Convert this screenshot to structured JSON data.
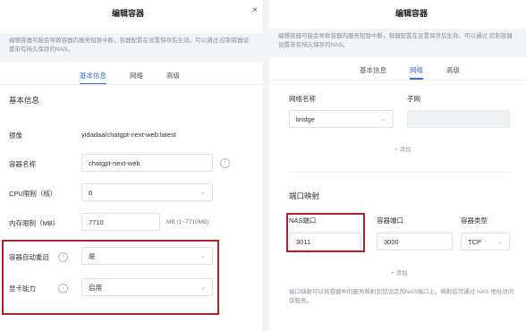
{
  "left_dialog": {
    "title": "编辑容器",
    "notice": "编辑容器可能会导致容器内服务短暂中断，容器配置在设置保存后生效。可以通过 控制容器设置带有持久保存的NAS。",
    "tabs": [
      "基本信息",
      "网络",
      "高级"
    ],
    "section_title": "基本信息",
    "rows": {
      "image_label": "镜像",
      "image_value": "yidadaa/chatgpt-next-web:latest",
      "container_name_label": "容器名称",
      "container_name_value": "chatgpt-next-web",
      "cpu_label": "CPU限制（核）",
      "cpu_value": "6",
      "memory_label": "内存限制（MB）",
      "memory_value": "7710",
      "memory_unit": "MB (1~7710MB)",
      "autostart_label": "容器自动重启",
      "autostart_value": "是",
      "gpu_label": "显卡能力",
      "gpu_value": "启用"
    }
  },
  "right_dialog": {
    "title": "编辑容器",
    "notice": "编辑容器可能会导致容器内服务短暂中断，容器配置在设置保存后生效。可以通过 控制容器设置带有持久保存的NAS。",
    "tabs": [
      "基本信息",
      "网络",
      "高级"
    ],
    "network": {
      "mode_label": "网络名称",
      "mode_value": "bridge",
      "subnet_label": "子网",
      "add_label": "+ 添加"
    },
    "port_section_title": "端口映射",
    "ports": {
      "nas_port_label": "NAS端口",
      "nas_port_value": "3011",
      "container_port_label": "容器端口",
      "container_port_value": "3000",
      "protocol_label": "容器类型",
      "protocol_value": "TCP",
      "add_label": "+ 添加"
    },
    "footnote": "端口映射可以将容器中的服务映射到您设定的NAS端口上，映射后可通过 NAS 地址访问该服务。"
  },
  "colors": {
    "accent": "#3b6fd6",
    "highlight": "#a3262a",
    "notice_bg": "#f2f4f7"
  }
}
